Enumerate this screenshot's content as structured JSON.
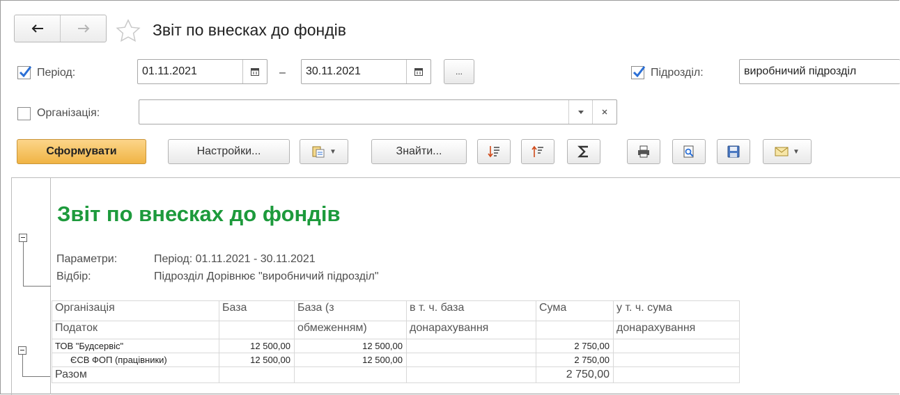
{
  "window": {
    "title": "Звіт по внесках до фондів"
  },
  "icons": {
    "back": "arrow-left-icon",
    "forward": "arrow-right-icon",
    "favorite": "star-icon",
    "calendar": "calendar-icon",
    "dropdown": "chevron-down-icon",
    "clear": "close-icon",
    "variants": "report-variants-icon",
    "sort_desc": "sort-descending-icon",
    "sort_asc": "sort-ascending-icon",
    "sum": "sigma-icon",
    "print": "printer-icon",
    "preview": "print-preview-icon",
    "save": "floppy-disk-icon",
    "email": "envelope-icon",
    "collapse": "collapse-minus-icon"
  },
  "colors": {
    "accent": "#f0b444",
    "report_title": "#1d9a3c",
    "checkmark": "#2a6fd6"
  },
  "filters": {
    "period": {
      "label": "Період:",
      "checked": true,
      "from": "01.11.2021",
      "dash": "–",
      "to": "30.11.2021",
      "more_label": "..."
    },
    "subdivision": {
      "label": "Підрозділ:",
      "checked": true,
      "value": "виробничий підрозділ"
    },
    "organization": {
      "label": "Організація:",
      "checked": false,
      "value": ""
    }
  },
  "toolbar": {
    "generate_label": "Сформувати",
    "settings_label": "Настройки...",
    "find_label": "Знайти..."
  },
  "report": {
    "title": "Звіт по внесках до фондів",
    "params_label": "Параметри:",
    "params_value": "Період: 01.11.2021 - 30.11.2021",
    "filter_label": "Відбір:",
    "filter_value": "Підрозділ Дорівнює \"виробничий підрозділ\"",
    "table": {
      "headers": [
        [
          "Організація",
          "База",
          "База (з",
          "в т. ч. база",
          "Сума",
          "у т. ч. сума"
        ],
        [
          "Податок",
          "",
          "обмеженням)",
          "донарахування",
          "",
          "донарахування"
        ]
      ],
      "rows": [
        {
          "name": "ТОВ \"Будсервіс\"",
          "base": "12 500,00",
          "base_limited": "12 500,00",
          "base_extra": "",
          "sum": "2 750,00",
          "sum_extra": ""
        },
        {
          "name": "ЄСВ ФОП (працівники)",
          "base": "12 500,00",
          "base_limited": "12 500,00",
          "base_extra": "",
          "sum": "2 750,00",
          "sum_extra": ""
        }
      ],
      "total": {
        "label": "Разом",
        "sum": "2 750,00"
      }
    }
  }
}
